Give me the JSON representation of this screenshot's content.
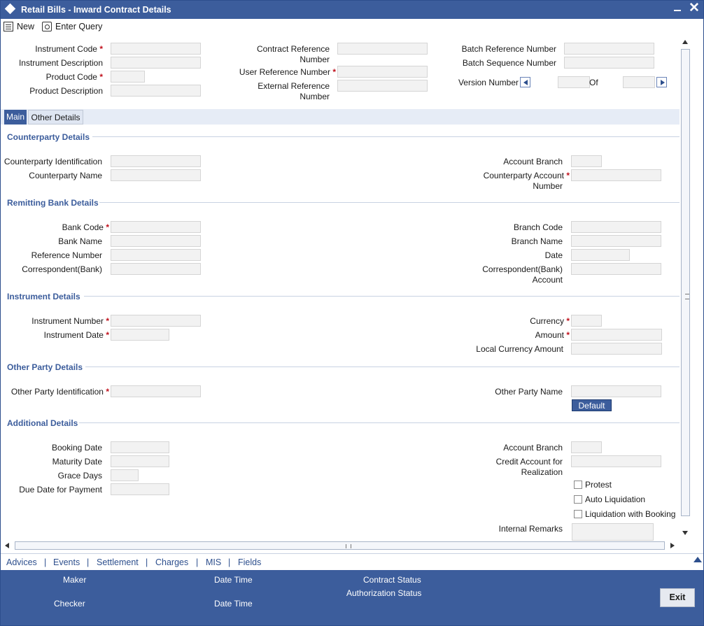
{
  "window": {
    "title": "Retail Bills - Inward Contract Details"
  },
  "toolbar": {
    "new_label": "New",
    "enter_query_label": "Enter Query"
  },
  "header": {
    "instrument_code": "Instrument Code",
    "instrument_description": "Instrument Description",
    "product_code": "Product Code",
    "product_description": "Product Description",
    "contract_reference": "Contract Reference",
    "contract_reference_2": "Number",
    "user_reference": "User Reference Number",
    "external_reference": "External Reference",
    "external_reference_2": "Number",
    "batch_reference": "Batch Reference Number",
    "batch_sequence": "Batch Sequence Number",
    "version_number": "Version Number",
    "of": "Of"
  },
  "tabs": {
    "main": "Main",
    "other_details": "Other Details"
  },
  "counterparty": {
    "title": "Counterparty Details",
    "identification": "Counterparty Identification",
    "name": "Counterparty Name",
    "account_branch": "Account Branch",
    "account_number": "Counterparty Account",
    "account_number_2": "Number"
  },
  "remitting": {
    "title": "Remitting Bank Details",
    "bank_code": "Bank Code",
    "bank_name": "Bank Name",
    "reference_number": "Reference Number",
    "correspondent": "Correspondent(Bank)",
    "branch_code": "Branch Code",
    "branch_name": "Branch Name",
    "date": "Date",
    "correspondent_account": "Correspondent(Bank)",
    "correspondent_account_2": "Account"
  },
  "instrument": {
    "title": "Instrument Details",
    "number": "Instrument Number",
    "date": "Instrument Date",
    "currency": "Currency",
    "amount": "Amount",
    "local_amount": "Local Currency Amount"
  },
  "other_party": {
    "title": "Other Party Details",
    "identification": "Other Party Identification",
    "name": "Other Party Name",
    "default_button": "Default"
  },
  "additional": {
    "title": "Additional Details",
    "booking_date": "Booking Date",
    "maturity_date": "Maturity Date",
    "grace_days": "Grace Days",
    "due_date": "Due Date for Payment",
    "account_branch": "Account Branch",
    "credit_account": "Credit Account for",
    "credit_account_2": "Realization",
    "protest": "Protest",
    "auto_liquidation": "Auto Liquidation",
    "liquidation_with_booking": "Liquidation with Booking",
    "internal_remarks": "Internal Remarks"
  },
  "nav": {
    "advices": "Advices",
    "events": "Events",
    "settlement": "Settlement",
    "charges": "Charges",
    "mis": "MIS",
    "fields": "Fields",
    "separator": "|"
  },
  "footer": {
    "maker": "Maker",
    "checker": "Checker",
    "date_time": "Date Time",
    "contract_status": "Contract Status",
    "authorization_status": "Authorization Status",
    "exit_button": "Exit"
  },
  "colors": {
    "accent": "#3c5d9c",
    "required": "#c0101c",
    "field_bg": "#f2f2f2"
  }
}
